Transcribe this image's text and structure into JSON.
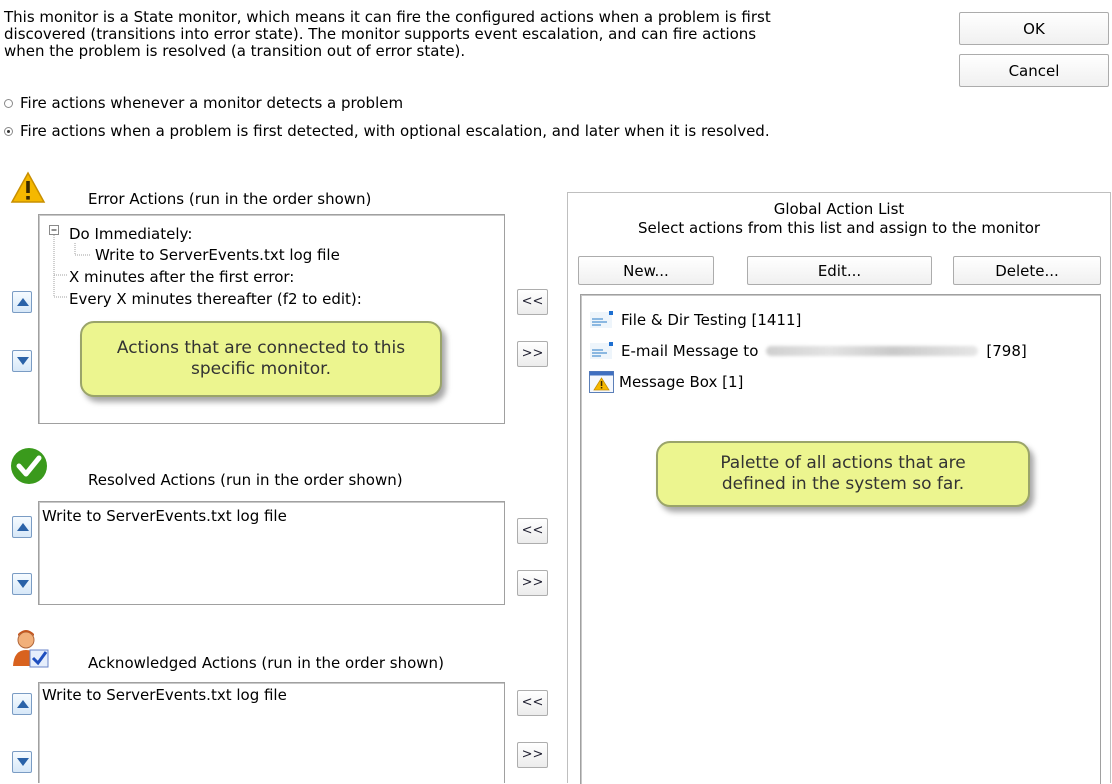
{
  "description": {
    "line1": "This monitor is a State monitor, which means it can fire the configured actions when a problem is first",
    "line2": "discovered (transitions into error state).  The monitor supports event escalation, and can fire actions",
    "line3": "when the problem is resolved (a transition out of error state)."
  },
  "buttons": {
    "ok": "OK",
    "cancel": "Cancel"
  },
  "radios": [
    {
      "label": "Fire actions whenever a monitor detects a problem",
      "selected": false
    },
    {
      "label": "Fire actions when a problem is first detected, with optional escalation, and later when it is resolved.",
      "selected": true
    }
  ],
  "error_actions": {
    "label": "Error Actions (run in the order shown)",
    "tree": {
      "do_immediately": "Do Immediately:",
      "write_log": "Write to ServerEvents.txt log file",
      "x_minutes": "X minutes after the first error:",
      "every_x": "Every X minutes thereafter (f2 to edit):"
    },
    "callout": "Actions that are connected to this specific monitor."
  },
  "resolved_actions": {
    "label": "Resolved Actions (run in the order shown)",
    "items": [
      "Write to ServerEvents.txt log file"
    ]
  },
  "acknowledged_actions": {
    "label": "Acknowledged Actions (run in the order shown)",
    "items": [
      "Write to ServerEvents.txt log file"
    ]
  },
  "move_buttons": {
    "left": "<<",
    "right": ">>"
  },
  "global": {
    "title": "Global Action List",
    "subtitle": "Select actions from this list and assign to the monitor",
    "new": "New...",
    "edit": "Edit...",
    "delete": "Delete...",
    "items": [
      {
        "label": "File & Dir Testing [1411]",
        "icon": "file-action-icon"
      },
      {
        "label": "E-mail Message to",
        "suffix": "[798]",
        "icon": "email-action-icon"
      },
      {
        "label": "Message Box [1]",
        "icon": "warning-icon"
      }
    ],
    "callout": "Palette of all actions that are defined in the system so far."
  },
  "colors": {
    "callout_bg": "#ecf58f",
    "check_green": "#3a9a1c",
    "warning_yellow": "#f5b800"
  }
}
